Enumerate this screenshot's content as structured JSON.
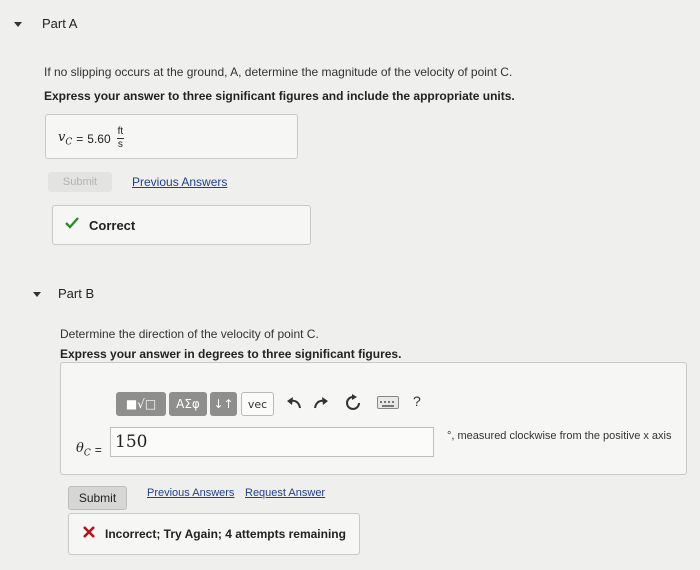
{
  "partA": {
    "title": "Part A",
    "question": "If no slipping occurs at the ground, A, determine the magnitude of the velocity of point C.",
    "instruction": "Express your answer to three significant figures and include the appropriate units.",
    "answer_label": "v",
    "answer_label_sub": "C",
    "answer_value": "5.60",
    "unit_numerator": "ft",
    "unit_denominator": "s",
    "submit_label": "Submit",
    "previous_answers_label": "Previous Answers",
    "feedback": "Correct"
  },
  "partB": {
    "title": "Part B",
    "question": "Determine the direction of the velocity of point C.",
    "instruction": "Express your answer in degrees to three significant figures.",
    "toolbar": {
      "templates": "■√□",
      "greek": "AΣφ",
      "arrows": "↓↑",
      "vec": "vec",
      "help": "?"
    },
    "answer_label": "θ",
    "answer_label_sub": "C",
    "answer_value": "150",
    "unit_text": "°, measured clockwise from the positive x axis",
    "submit_label": "Submit",
    "previous_answers_label": "Previous Answers",
    "request_answer_label": "Request Answer",
    "feedback": "Incorrect; Try Again; 4 attempts remaining"
  },
  "colors": {
    "correct": "#2e8b2e",
    "incorrect": "#b5121b",
    "link": "#1f3f8f"
  }
}
